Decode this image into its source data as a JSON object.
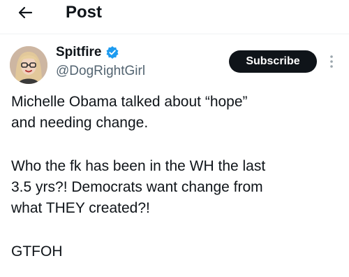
{
  "header": {
    "title": "Post",
    "back_icon": "arrow-left-icon"
  },
  "author": {
    "display_name": "Spitfire",
    "handle": "@DogRightGirl",
    "verified": true,
    "verified_color": "#1d9bf0",
    "avatar_icon": "avatar-photo"
  },
  "actions": {
    "subscribe_label": "Subscribe",
    "more_icon": "more-vertical-icon"
  },
  "post": {
    "line1": "Michelle Obama talked about “hope”",
    "line2": "and needing change.",
    "line3": "Who the fk has been in the WH the last",
    "line4": "3.5 yrs?! Democrats want change from",
    "line5": "what THEY created?!",
    "line6": "GTFOH"
  },
  "colors": {
    "text": "#0f1419",
    "secondary": "#536471",
    "button": "#0f1419"
  }
}
